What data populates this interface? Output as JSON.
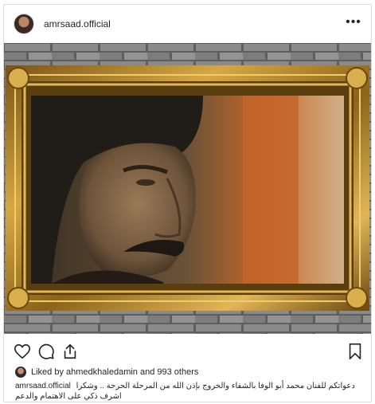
{
  "post": {
    "username": "amrsaad.official",
    "more_icon": "more-horizontal-icon",
    "actions": {
      "like_icon": "heart-icon",
      "comment_icon": "comment-icon",
      "share_icon": "share-icon",
      "save_icon": "bookmark-icon"
    },
    "liked_by": "Liked by ahmedkhaledamin and 993 others",
    "caption_user": "amrsaad.official",
    "caption_text": "دعواتكم للفنان محمد أبو الوفا بالشفاء والخروج بإذن الله من المرحلة الحرجة .. وشكرا اشرف ذكي على الاهتمام والدعم"
  },
  "colors": {
    "frame_gold": "#b88a2a",
    "brick": "#6e6e6e",
    "text": "#262626"
  }
}
